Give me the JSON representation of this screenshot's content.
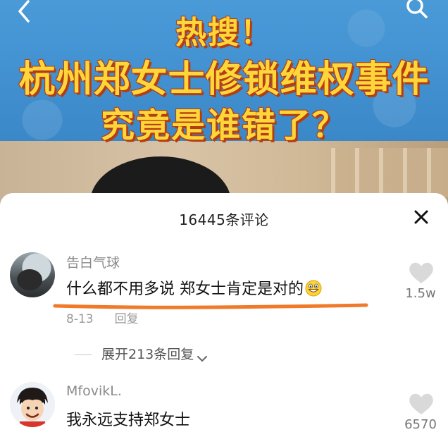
{
  "video": {
    "headline_line1": "热搜！",
    "headline_line2": "杭州郑女士修锁维权事件",
    "headline_line3": "究竟是谁错了？"
  },
  "comments_panel": {
    "title": "16445条评论",
    "comments": [
      {
        "username": "告白气球",
        "text": "什么都不用多说 郑女士肯定是对的",
        "emoji": "grinning-face-icon",
        "date": "8-13",
        "reply_label": "回复",
        "likes": "1.5w",
        "expand_label": "展开213条回复"
      },
      {
        "username": "MfovikL.",
        "text": "我永远支持郑女士",
        "likes": "6570"
      }
    ]
  },
  "colors": {
    "headline": "#ffd63a",
    "headline_outline": "#b43d12",
    "banner": "#3d8fd0",
    "underline_annotation": "#f07a2a"
  }
}
